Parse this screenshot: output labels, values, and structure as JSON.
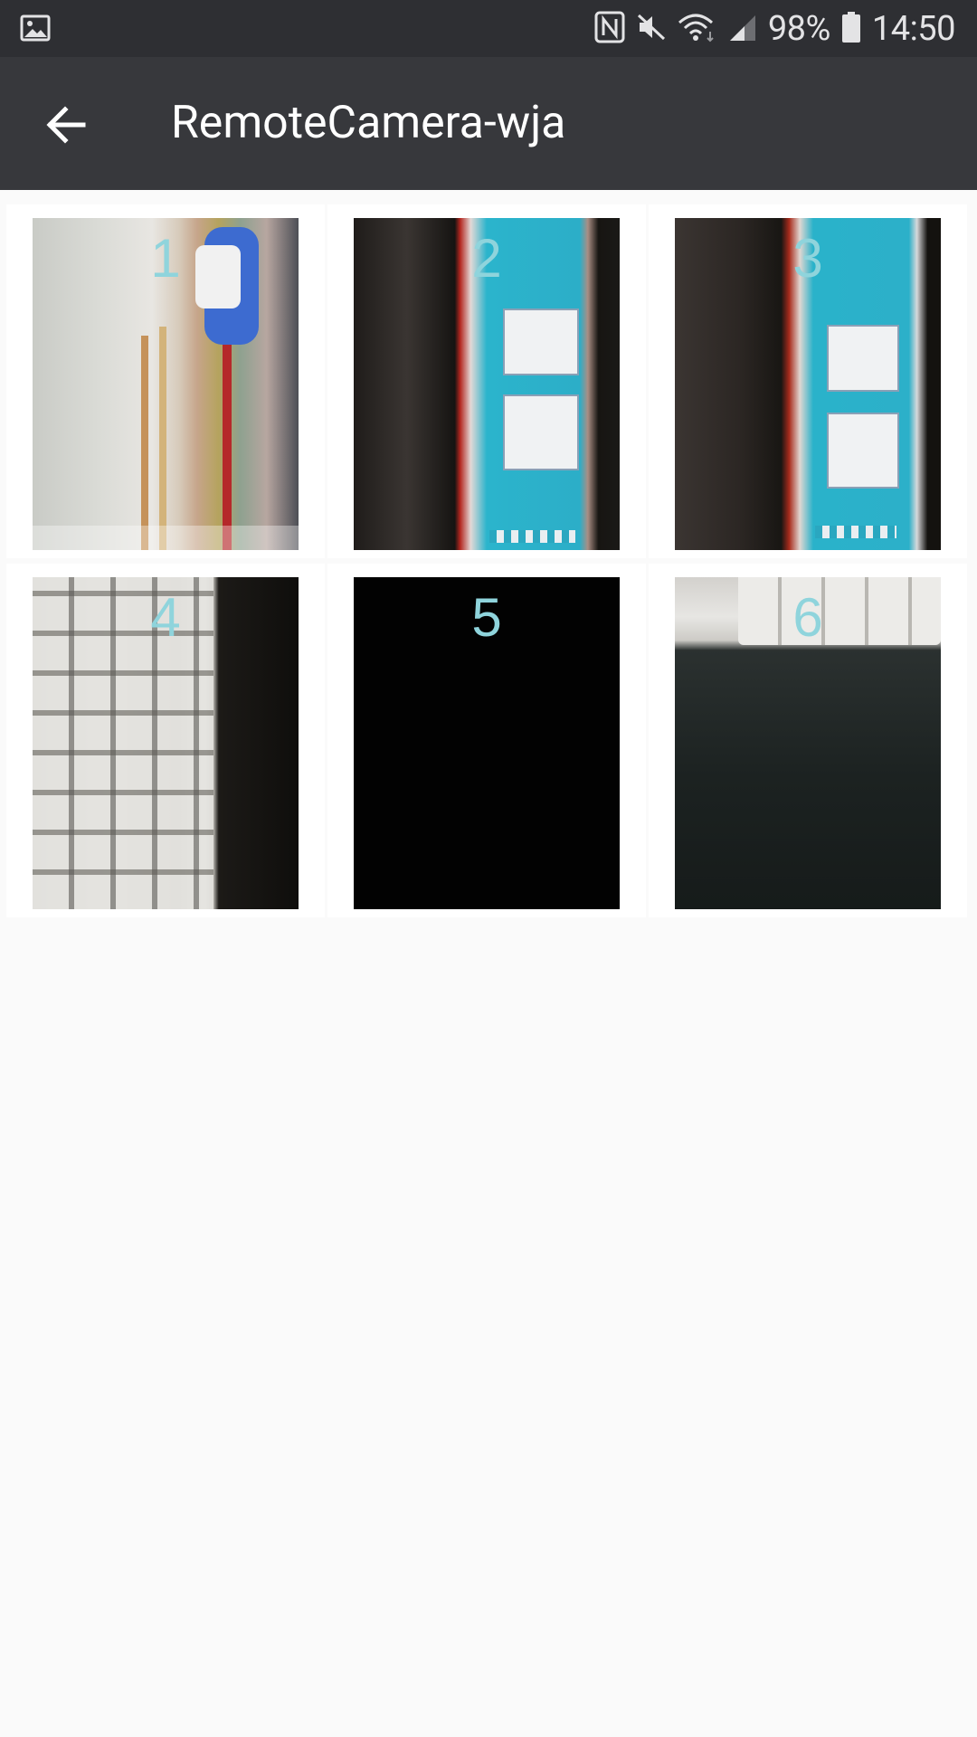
{
  "status_bar": {
    "battery": "98%",
    "time": "14:50",
    "icons": [
      "gallery-notification-icon",
      "nfc-icon",
      "mute-icon",
      "wifi-icon",
      "signal-icon",
      "battery-icon"
    ]
  },
  "app_bar": {
    "title": "RemoteCamera-wja",
    "back_icon": "arrow-back-icon"
  },
  "colors": {
    "status_bar_bg": "#2e2f33",
    "app_bar_bg": "#37383c",
    "page_bg": "#fafafa",
    "number_overlay": "#8fd4dc"
  },
  "photos": [
    {
      "number": "1",
      "scene": "bookshelf"
    },
    {
      "number": "2",
      "scene": "monitor-screen"
    },
    {
      "number": "3",
      "scene": "monitor-screen"
    },
    {
      "number": "4",
      "scene": "keyboard"
    },
    {
      "number": "5",
      "scene": "dark"
    },
    {
      "number": "6",
      "scene": "keyboard-on-desk"
    }
  ]
}
